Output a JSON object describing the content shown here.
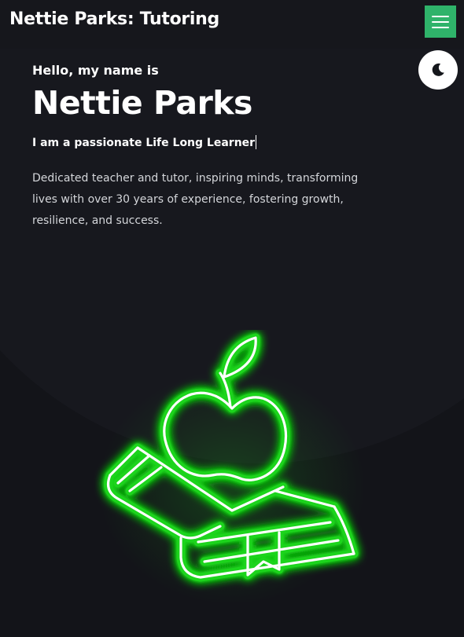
{
  "navbar": {
    "brand": "Nettie Parks: Tutoring",
    "menu_icon": "hamburger-menu-icon",
    "accent_color": "#2fb36a"
  },
  "theme_toggle": {
    "icon": "moon-icon"
  },
  "hero": {
    "greeting": "Hello, my name is",
    "name": "Nettie Parks",
    "typed_text": "I am a passionate Life Long Learner",
    "bio": "Dedicated teacher and tutor, inspiring minds, transforming lives with over 30 years of experience, fostering growth, resilience, and success.",
    "illustration": "neon-apple-on-book-icon",
    "neon_color": "#1ed41e"
  }
}
